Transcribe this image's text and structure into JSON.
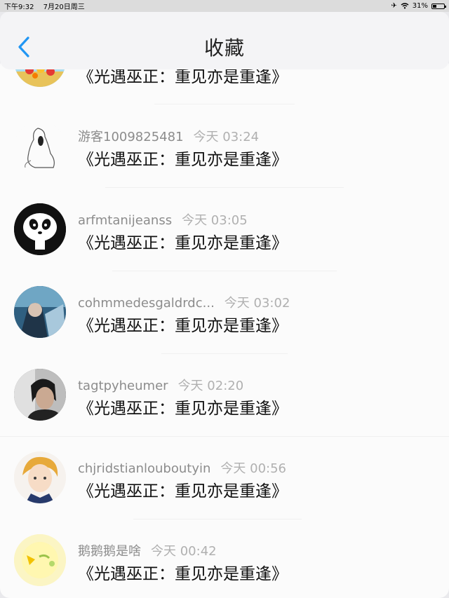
{
  "status": {
    "time": "下午9:32",
    "date": "7月20日周三",
    "battery": "31%",
    "battery_level": 0.31
  },
  "header": {
    "title": "收藏",
    "back_icon": "chevron-left-icon",
    "accent": "#2196f3"
  },
  "items": [
    {
      "user": "",
      "time": "",
      "content": "《光遇巫正：重见亦是重逢》"
    },
    {
      "user": "游客1009825481",
      "time": "今天 03:24",
      "content": "《光遇巫正：重见亦是重逢》"
    },
    {
      "user": "arfmtanijeanss",
      "time": "今天 03:05",
      "content": "《光遇巫正：重见亦是重逢》"
    },
    {
      "user": "cohmmedesgaldrdc...",
      "time": "今天 03:02",
      "content": "《光遇巫正：重见亦是重逢》"
    },
    {
      "user": "tagtpyheumer",
      "time": "今天 02:20",
      "content": "《光遇巫正：重见亦是重逢》"
    },
    {
      "user": "chjridstianlouboutyin",
      "time": "今天 00:56",
      "content": "《光遇巫正：重见亦是重逢》"
    },
    {
      "user": "鹅鹅鹅是啥",
      "time": "今天 00:42",
      "content": "《光遇巫正：重见亦是重逢》"
    }
  ]
}
